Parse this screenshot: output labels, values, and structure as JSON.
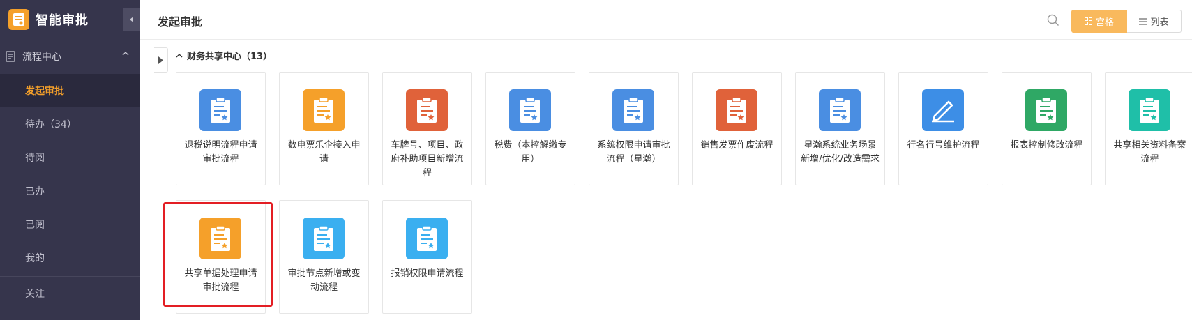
{
  "sidebar": {
    "app_title": "智能审批",
    "section": {
      "label": "流程中心"
    },
    "items": [
      {
        "label": "发起审批",
        "active": true
      },
      {
        "label": "待办（34）",
        "active": false
      },
      {
        "label": "待阅",
        "active": false
      },
      {
        "label": "已办",
        "active": false
      },
      {
        "label": "已阅",
        "active": false
      },
      {
        "label": "我的",
        "active": false
      }
    ],
    "follow_label": "关注"
  },
  "header": {
    "title": "发起审批",
    "grid_label": "宫格",
    "list_label": "列表"
  },
  "group": {
    "title": "财务共享中心（13）",
    "cards": [
      {
        "label": "退税说明流程申请审批流程",
        "color": "#4a8ee2",
        "icon": "clipboard-icon"
      },
      {
        "label": "数电票乐企接入申请",
        "color": "#f5a02a",
        "icon": "clipboard-icon"
      },
      {
        "label": "车牌号、项目、政府补助项目新增流程",
        "color": "#e0623a",
        "icon": "clipboard-icon"
      },
      {
        "label": "税费（本控解缴专用）",
        "color": "#4a8ee2",
        "icon": "clipboard-icon"
      },
      {
        "label": "系统权限申请审批流程（星瀚）",
        "color": "#4a8ee2",
        "icon": "clipboard-icon"
      },
      {
        "label": "销售发票作废流程",
        "color": "#e0623a",
        "icon": "clipboard-icon"
      },
      {
        "label": "星瀚系统业务场景新增/优化/改造需求",
        "color": "#4a8ee2",
        "icon": "clipboard-icon"
      },
      {
        "label": "行名行号维护流程",
        "color": "#3d8ee6",
        "icon": "pencil-icon"
      },
      {
        "label": "报表控制修改流程",
        "color": "#2fa865",
        "icon": "clipboard-icon"
      },
      {
        "label": "共享相关资料备案流程",
        "color": "#1fbfa8",
        "icon": "clipboard-icon"
      },
      {
        "label": "共享单据处理申请审批流程",
        "color": "#f5a02a",
        "icon": "clipboard-icon"
      },
      {
        "label": "审批节点新增或变动流程",
        "color": "#3aaff0",
        "icon": "clipboard-icon"
      },
      {
        "label": "报销权限申请流程",
        "color": "#3aaff0",
        "icon": "clipboard-icon"
      }
    ]
  }
}
